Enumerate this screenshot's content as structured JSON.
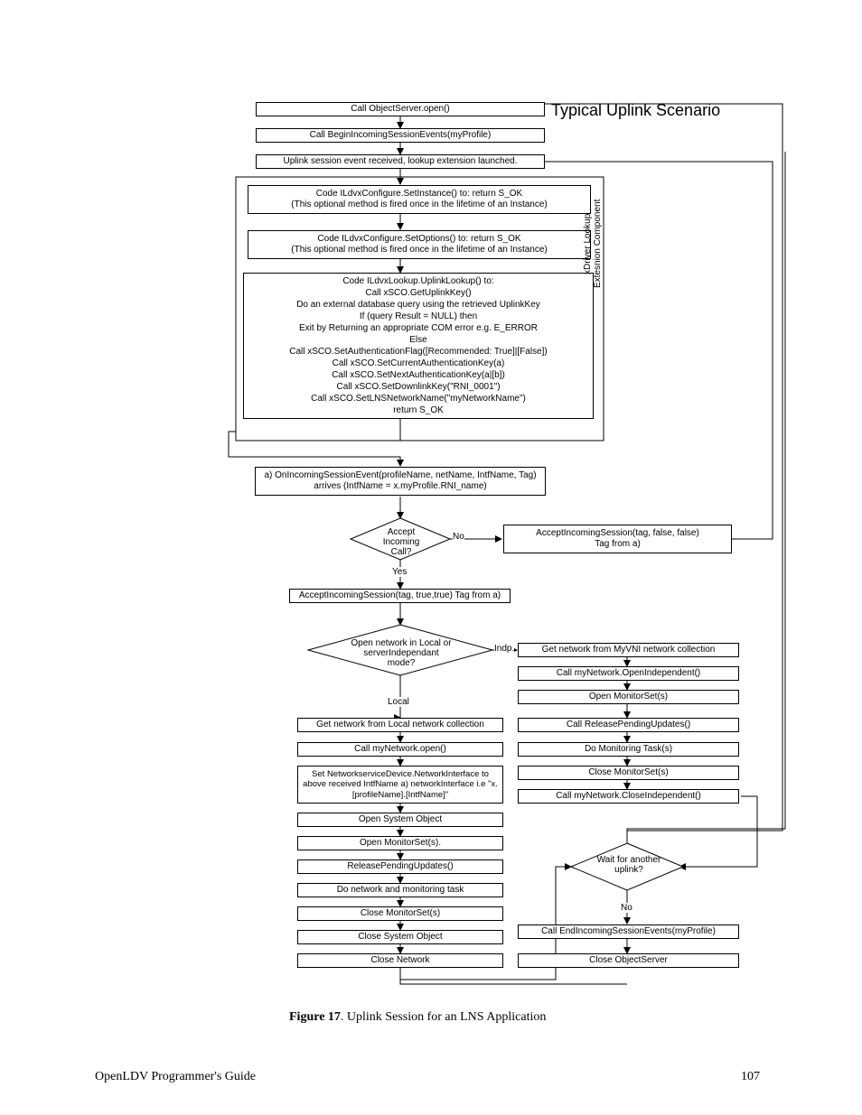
{
  "title": "Typical Uplink Scenario",
  "sidebarLabel": "xDriver Lookup\nExtesnion Component",
  "top": {
    "n1": "Call ObjectServer.open()",
    "n2": "Call BeginIncomingSessionEvents(myProfile)",
    "n3": "Uplink session event received, lookup extension launched."
  },
  "xdrv": {
    "n4": "Code ILdvxConfigure.SetInstance() to: return S_OK\n(This optional method is fired once in the lifetime of an Instance)",
    "n5": "Code ILdvxConfigure.SetOptions() to: return S_OK\n(This optional method is fired once in the lifetime of an Instance)",
    "n6": "Code ILdvxLookup.UplinkLookup() to:\nCall xSCO.GetUplinkKey()\nDo an external database query using the retrieved UplinkKey\nIf (query Result = NULL) then\nExit by Returning an appropriate COM error e.g. E_ERROR\nElse\nCall xSCO.SetAuthenticationFlag([Recommended: True]|[False])\nCall xSCO.SetCurrentAuthenticationKey(a)\nCall xSCO.SetNextAuthenticationKey(a|[b])\nCall xSCO.SetDownlinkKey(\"RNI_0001\")\nCall xSCO.SetLNSNetworkName(\"myNetworkName\")\nreturn S_OK"
  },
  "mid": {
    "n7": "a) OnIncomingSessionEvent(profileName, netName, IntfName, Tag)\narrives (IntfName = x.myProfile.RNI_name)",
    "d1": "Accept\nIncoming Call?",
    "d1no": "No",
    "d1yes": "Yes",
    "n8": "AcceptIncomingSession(tag, false, false)\nTag from a)",
    "n9": "AcceptIncomingSession(tag, true,true) Tag from a)",
    "d2": "Open network in Local or\nserverIndependant mode?",
    "d2indp": "Indp.",
    "d2local": "Local"
  },
  "left": {
    "l1": "Get network from Local network collection",
    "l2": "Call myNetwork.open()",
    "l3": "Set NetworkserviceDevice.NetworkInterface to above received IntfName a) networkInterface i.e \"x.[profileName].[IntfName]\"",
    "l4": "Open System Object",
    "l5": "Open MonitorSet(s).",
    "l6": "ReleasePendingUpdates()",
    "l7": "Do network and monitoring task",
    "l8": "Close MonitorSet(s)",
    "l9": "Close System Object",
    "l10": "Close Network"
  },
  "right": {
    "r1": "Get network from MyVNI network collection",
    "r2": "Call myNetwork.OpenIndependent()",
    "r3": "Open MonitorSet(s)",
    "r4": "Call ReleasePendingUpdates()",
    "r5": "Do Monitoring Task(s)",
    "r6": "Close MonitorSet(s)",
    "r7": "Call myNetwork.CloseIndependent()",
    "d3": "Wait for another\nuplink?",
    "d3no": "No",
    "r8": "Call EndIncomingSessionEvents(myProfile)",
    "r9": "Close ObjectServer"
  },
  "caption": {
    "bold": "Figure 17",
    "rest": ". Uplink Session for an LNS Application"
  },
  "footerLeft": "OpenLDV Programmer's Guide",
  "footerRight": "107"
}
